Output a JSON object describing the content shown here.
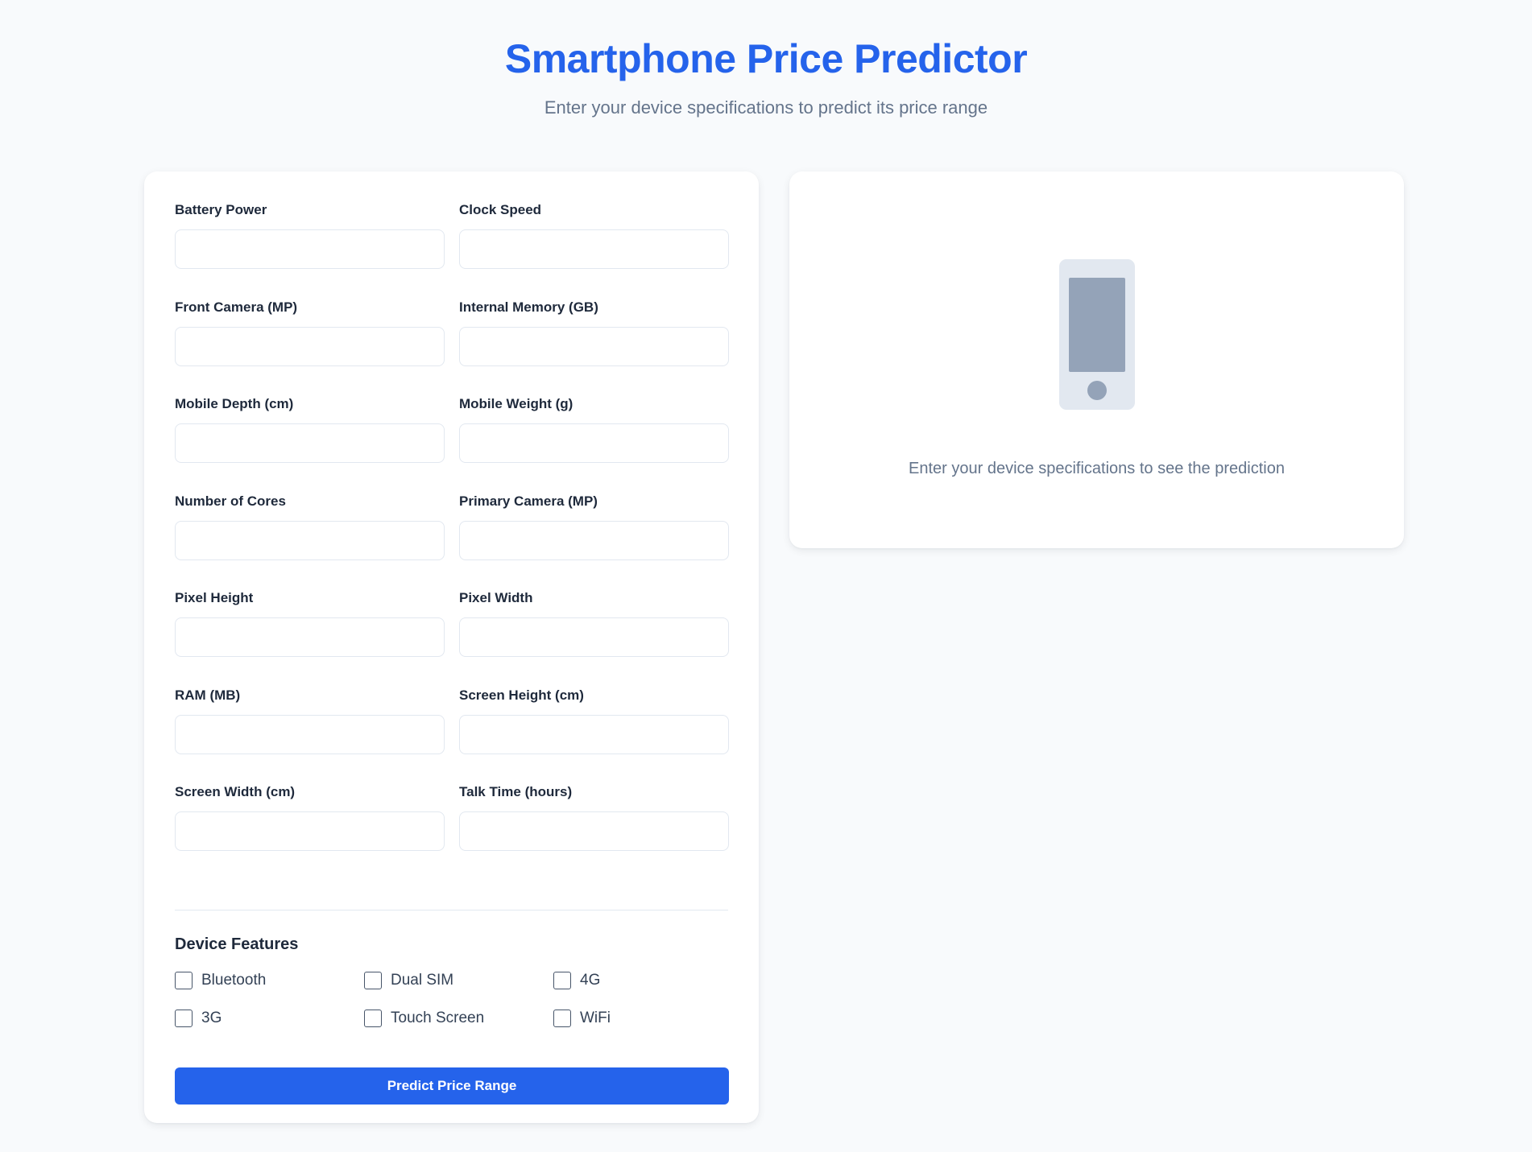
{
  "header": {
    "title": "Smartphone Price Predictor",
    "subtitle": "Enter your device specifications to predict its price range"
  },
  "form": {
    "fields": [
      {
        "label": "Battery Power",
        "value": ""
      },
      {
        "label": "Clock Speed",
        "value": ""
      },
      {
        "label": "Front Camera (MP)",
        "value": ""
      },
      {
        "label": "Internal Memory (GB)",
        "value": ""
      },
      {
        "label": "Mobile Depth (cm)",
        "value": ""
      },
      {
        "label": "Mobile Weight (g)",
        "value": ""
      },
      {
        "label": "Number of Cores",
        "value": ""
      },
      {
        "label": "Primary Camera (MP)",
        "value": ""
      },
      {
        "label": "Pixel Height",
        "value": ""
      },
      {
        "label": "Pixel Width",
        "value": ""
      },
      {
        "label": "RAM (MB)",
        "value": ""
      },
      {
        "label": "Screen Height (cm)",
        "value": ""
      },
      {
        "label": "Screen Width (cm)",
        "value": ""
      },
      {
        "label": "Talk Time (hours)",
        "value": ""
      }
    ],
    "features_title": "Device Features",
    "features": [
      {
        "label": "Bluetooth",
        "checked": false
      },
      {
        "label": "Dual SIM",
        "checked": false
      },
      {
        "label": "4G",
        "checked": false
      },
      {
        "label": "3G",
        "checked": false
      },
      {
        "label": "Touch Screen",
        "checked": false
      },
      {
        "label": "WiFi",
        "checked": false
      }
    ],
    "submit_label": "Predict Price Range"
  },
  "result": {
    "icon": "smartphone-icon",
    "placeholder_text": "Enter your device specifications to see the prediction"
  },
  "colors": {
    "accent": "#2563eb",
    "background": "#f8fafc",
    "muted_text": "#64748b",
    "phone_icon_body": "#e2e8f0",
    "phone_icon_detail": "#94a3b8"
  }
}
